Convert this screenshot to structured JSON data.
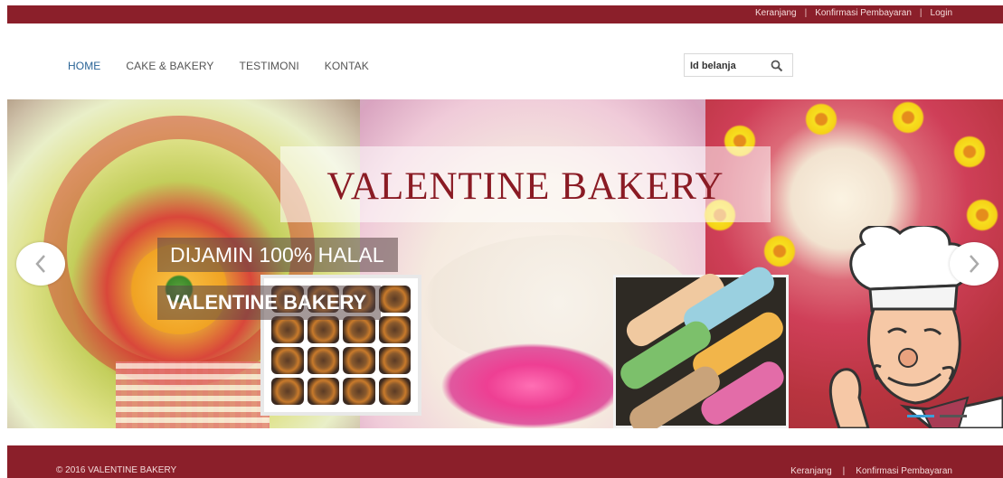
{
  "topbar": {
    "links": [
      "Keranjang",
      "Konfirmasi Pembayaran",
      "Login"
    ],
    "separator": "|"
  },
  "nav": {
    "items": [
      "HOME",
      "CAKE & BAKERY",
      "TESTIMONI",
      "KONTAK"
    ],
    "active": "HOME"
  },
  "search": {
    "placeholder": "Id belanja",
    "icon": "search-icon"
  },
  "hero": {
    "title": "VALENTINE BAKERY",
    "caption_halal": "DIJAMIN 100% HALAL",
    "caption_brand": "VALENTINE BAKERY",
    "prev_icon": "chevron-left-icon",
    "next_icon": "chevron-right-icon",
    "slides": 2,
    "active_slide": 1
  },
  "footer": {
    "copyright": "© 2016 VALENTINE BAKERY",
    "links": [
      "Keranjang",
      "Konfirmasi Pembayaran"
    ],
    "separator": "|"
  },
  "colors": {
    "brand": "#8b1f2a",
    "nav_active": "#2a6496",
    "title_text": "#8a1b24",
    "indicator_active": "#3aa0d8"
  }
}
